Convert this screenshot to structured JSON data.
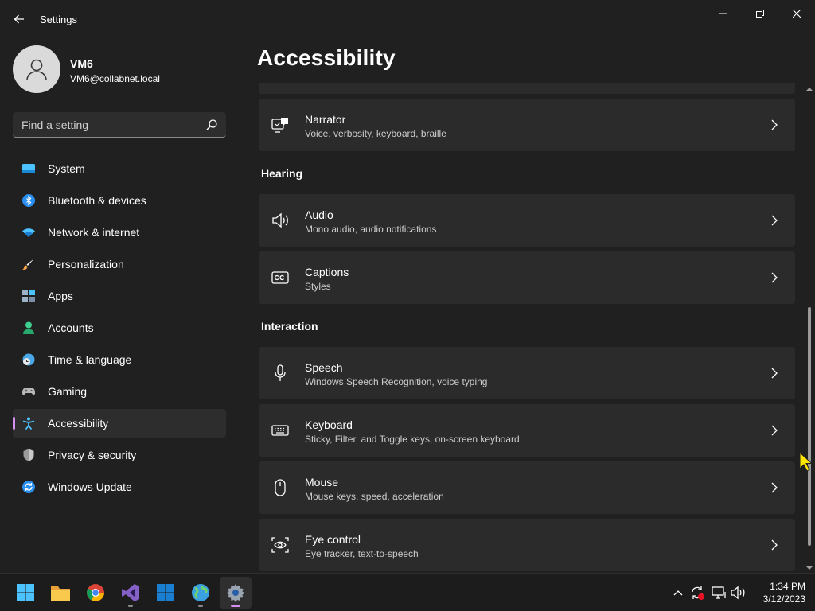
{
  "app": {
    "title": "Settings"
  },
  "user": {
    "name": "VM6",
    "email": "VM6@collabnet.local"
  },
  "search": {
    "placeholder": "Find a setting"
  },
  "nav": {
    "items": [
      {
        "label": "System",
        "icon": "monitor-icon"
      },
      {
        "label": "Bluetooth & devices",
        "icon": "bluetooth-icon"
      },
      {
        "label": "Network & internet",
        "icon": "wifi-icon"
      },
      {
        "label": "Personalization",
        "icon": "brush-icon"
      },
      {
        "label": "Apps",
        "icon": "apps-icon"
      },
      {
        "label": "Accounts",
        "icon": "person-icon"
      },
      {
        "label": "Time & language",
        "icon": "globe-clock-icon"
      },
      {
        "label": "Gaming",
        "icon": "gamepad-icon"
      },
      {
        "label": "Accessibility",
        "icon": "accessibility-icon",
        "selected": true
      },
      {
        "label": "Privacy & security",
        "icon": "shield-icon"
      },
      {
        "label": "Windows Update",
        "icon": "update-icon"
      }
    ]
  },
  "page": {
    "title": "Accessibility"
  },
  "cards": {
    "narrator": {
      "title": "Narrator",
      "subtitle": "Voice, verbosity, keyboard, braille",
      "icon": "narrator-icon"
    },
    "audio": {
      "title": "Audio",
      "subtitle": "Mono audio, audio notifications",
      "icon": "speaker-icon"
    },
    "captions": {
      "title": "Captions",
      "subtitle": "Styles",
      "icon": "cc-icon"
    },
    "speech": {
      "title": "Speech",
      "subtitle": "Windows Speech Recognition, voice typing",
      "icon": "microphone-icon"
    },
    "keyboard": {
      "title": "Keyboard",
      "subtitle": "Sticky, Filter, and Toggle keys, on-screen keyboard",
      "icon": "keyboard-icon"
    },
    "mouse": {
      "title": "Mouse",
      "subtitle": "Mouse keys, speed, acceleration",
      "icon": "mouse-icon"
    },
    "eye_control": {
      "title": "Eye control",
      "subtitle": "Eye tracker, text-to-speech",
      "icon": "eye-icon"
    }
  },
  "sections": {
    "hearing": "Hearing",
    "interaction": "Interaction"
  },
  "taskbar": {
    "apps": [
      "windows-start-icon",
      "file-explorer-icon",
      "chrome-icon",
      "visual-studio-icon",
      "windows-store-icon",
      "globe-icon",
      "settings-gear-icon"
    ],
    "time": "1:34 PM",
    "date": "3/12/2023"
  },
  "colors": {
    "accent": "#d28ff0",
    "background": "#202020",
    "card": "#2b2b2b"
  }
}
